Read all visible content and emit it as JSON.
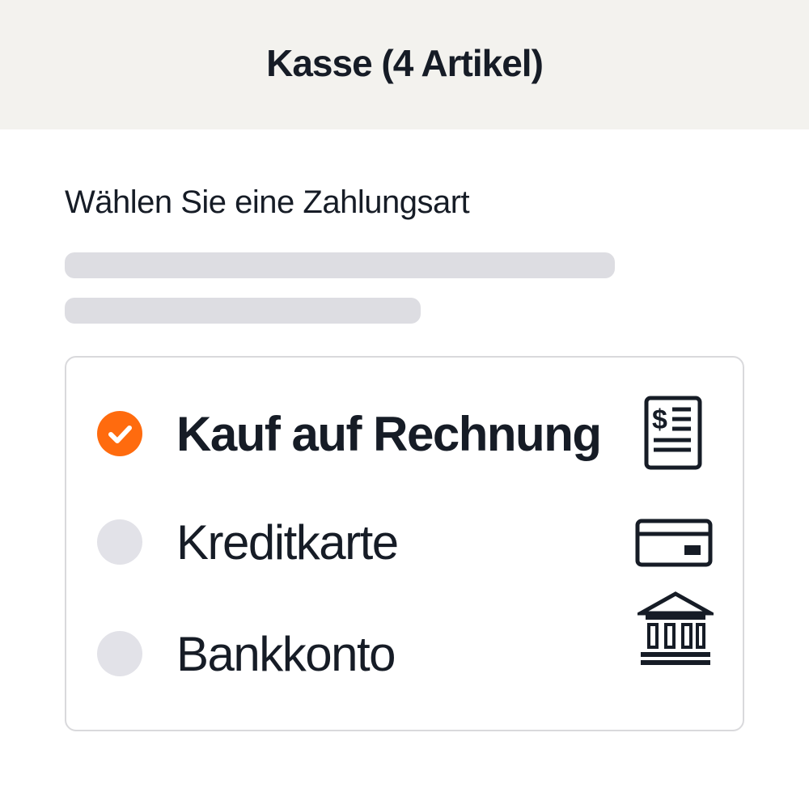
{
  "header": {
    "title": "Kasse (4 Artikel)"
  },
  "payment": {
    "prompt": "Wählen Sie eine Zahlungsart",
    "selected_index": 0,
    "options": [
      {
        "label": "Kauf auf Rechnung",
        "icon": "invoice-icon",
        "selected": true
      },
      {
        "label": "Kreditkarte",
        "icon": "credit-card-icon",
        "selected": false
      },
      {
        "label": "Bankkonto",
        "icon": "bank-icon",
        "selected": false
      }
    ]
  },
  "colors": {
    "header_bg": "#f3f2ee",
    "accent": "#ff6b0e",
    "text": "#161c26",
    "skeleton": "#dddde2",
    "radio_unselected": "#e2e2e8",
    "card_border": "#d9d9dc"
  }
}
